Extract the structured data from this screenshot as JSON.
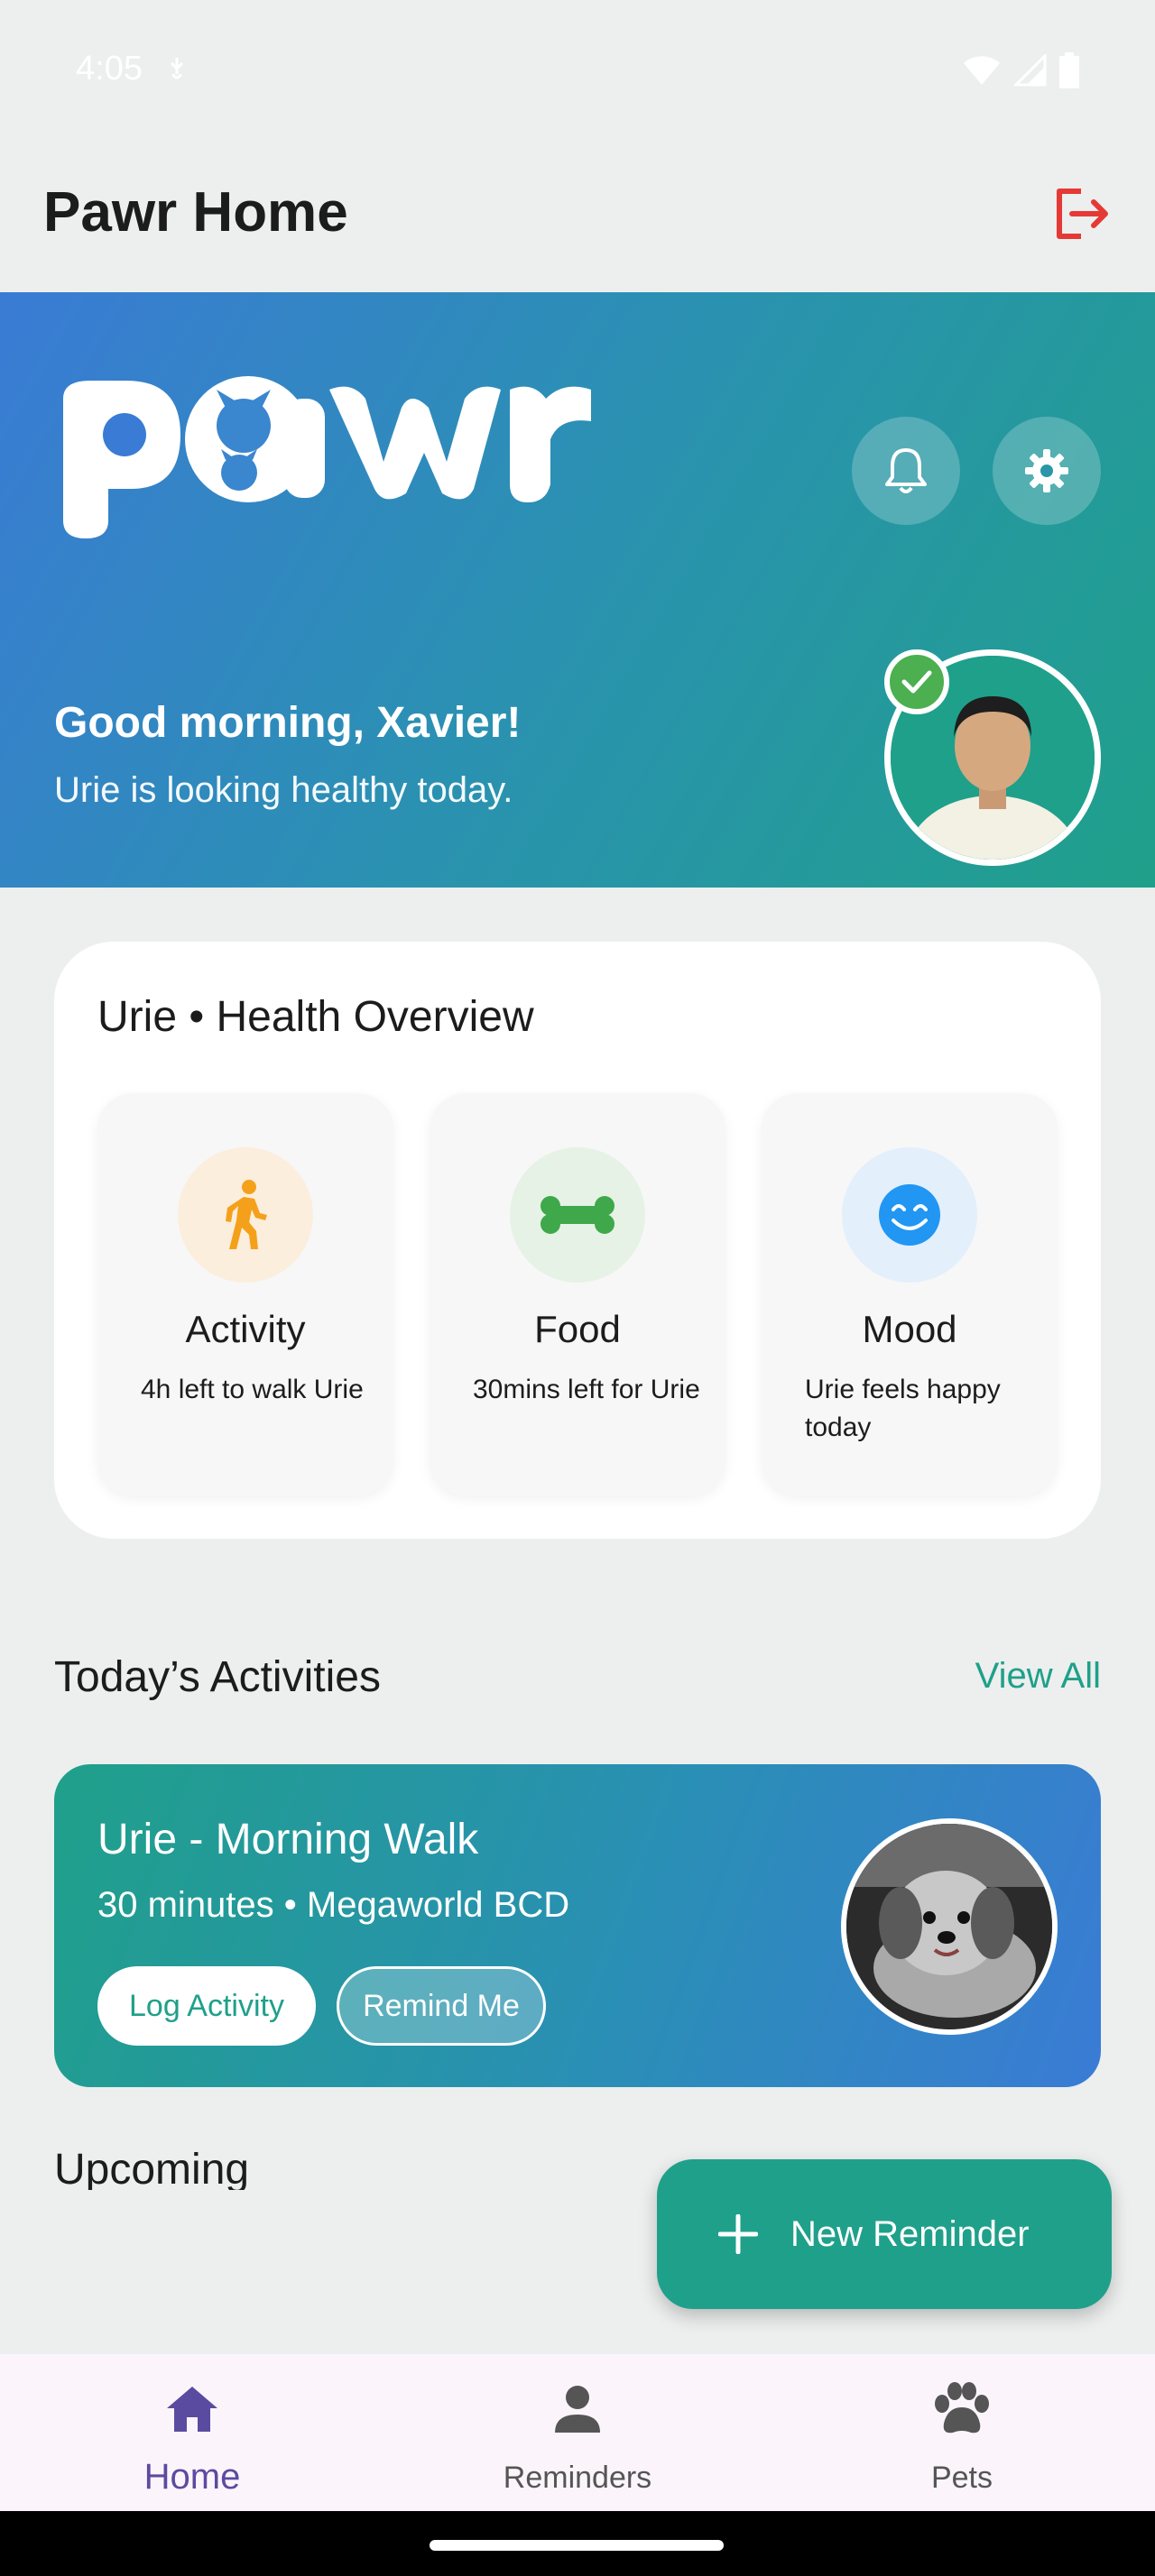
{
  "status_bar": {
    "time": "4:05"
  },
  "app_bar": {
    "title": "Pawr Home"
  },
  "hero": {
    "greeting": "Good morning, Xavier!",
    "subtitle": "Urie is looking healthy today."
  },
  "health": {
    "title": "Urie • Health Overview",
    "stats": [
      {
        "label": "Activity",
        "desc": "4h left to walk Urie",
        "icon": "walk-icon"
      },
      {
        "label": "Food",
        "desc": "30mins left for Urie",
        "icon": "bone-icon"
      },
      {
        "label": "Mood",
        "desc": "Urie feels happy today",
        "icon": "smile-icon"
      }
    ]
  },
  "activities": {
    "title": "Today’s Activities",
    "view_all": "View All",
    "card": {
      "title": "Urie - Morning Walk",
      "meta": "30 minutes • Megaworld BCD",
      "log_label": "Log Activity",
      "remind_label": "Remind Me"
    }
  },
  "upcoming": {
    "title": "Upcoming"
  },
  "fab": {
    "label": "New Reminder"
  },
  "nav": {
    "items": [
      {
        "label": "Home",
        "icon": "home-icon",
        "active": true
      },
      {
        "label": "Reminders",
        "icon": "person-icon",
        "active": false
      },
      {
        "label": "Pets",
        "icon": "paw-icon",
        "active": false
      }
    ]
  },
  "colors": {
    "accent": "#1FA08A",
    "hero_start": "#3A7BD5",
    "hero_end": "#1FA08A",
    "danger": "#E53935",
    "nav_active": "#5B4BA0"
  }
}
